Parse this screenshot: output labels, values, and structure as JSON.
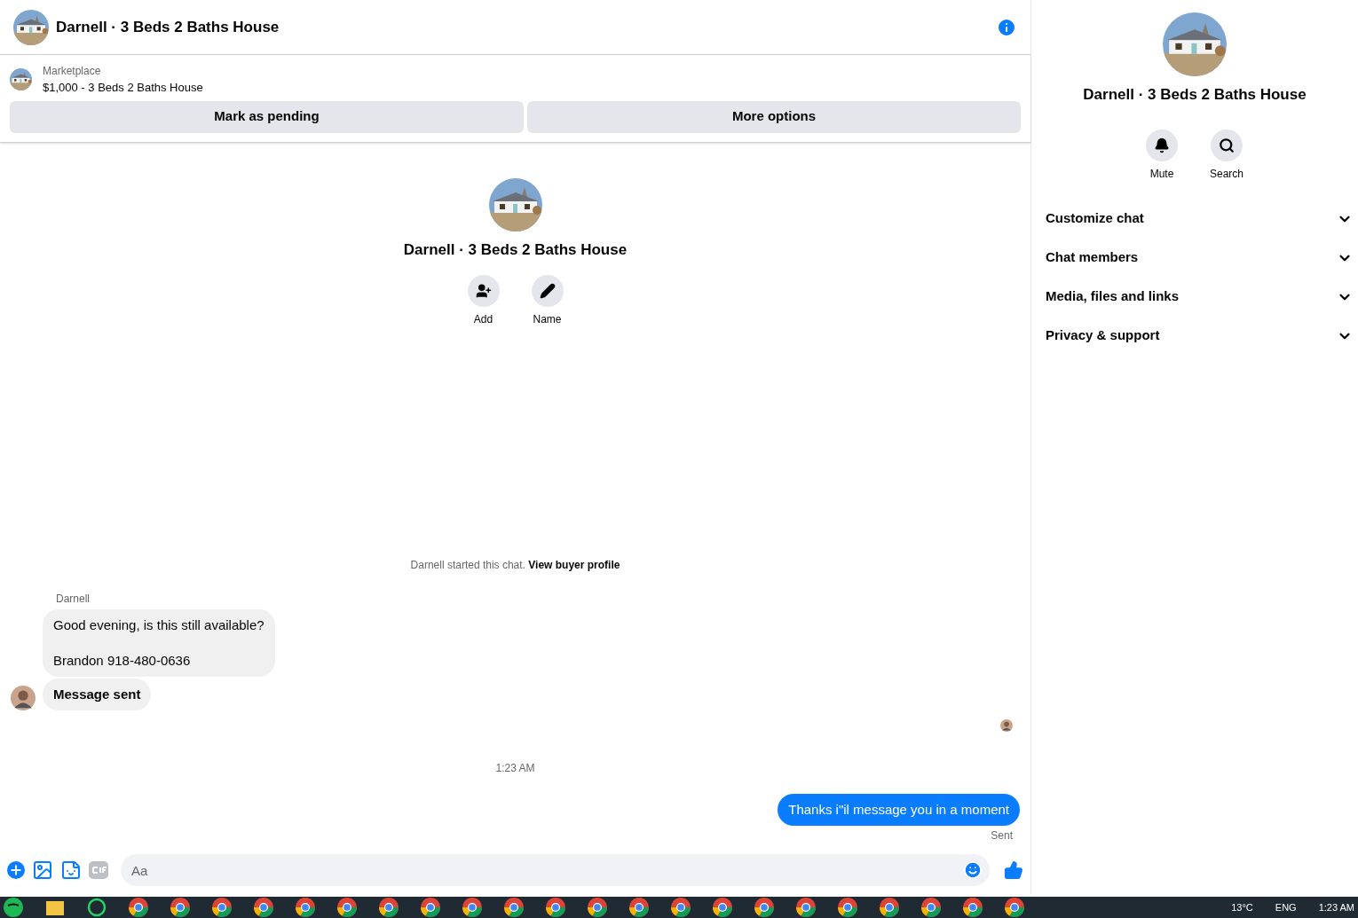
{
  "header": {
    "title": "Darnell · 3 Beds 2 Baths House"
  },
  "listing": {
    "source": "Marketplace",
    "title": "$1,000 - 3 Beds 2 Baths House",
    "buttons": [
      "Mark as pending",
      "More options"
    ]
  },
  "intro": {
    "title": "Darnell · 3 Beds 2 Baths House",
    "actions": [
      {
        "kind": "add",
        "label": "Add"
      },
      {
        "kind": "edit",
        "label": "Name"
      }
    ]
  },
  "started": {
    "text": "Darnell started this chat.",
    "link": "View buyer profile"
  },
  "messages": [
    {
      "kind": "incoming",
      "sender": "Darnell",
      "lines": [
        "Good evening, is this still available?",
        "Brandon 918-480-0636"
      ],
      "bold": false
    },
    {
      "kind": "incoming",
      "lines": [
        "Message sent"
      ],
      "bold": true
    },
    {
      "kind": "seen"
    },
    {
      "kind": "time",
      "text": "1:23 AM"
    },
    {
      "kind": "outgoing",
      "lines": [
        "Thanks i\"il message you in a moment"
      ],
      "status": "Sent"
    }
  ],
  "composer": {
    "placeholder": "Aa"
  },
  "panel": {
    "title": "Darnell · 3 Beds 2 Baths House",
    "actions": [
      {
        "kind": "mute",
        "label": "Mute"
      },
      {
        "kind": "search",
        "label": "Search"
      }
    ],
    "sections": [
      {
        "label": "Customize chat",
        "expanded": false
      },
      {
        "label": "Chat members",
        "expanded": false
      },
      {
        "label": "Media, files and links",
        "expanded": false
      },
      {
        "label": "Privacy & support",
        "expanded": false
      }
    ]
  },
  "taskbar": {
    "apps": [
      {
        "kind": "spotify"
      },
      {
        "kind": "folder"
      },
      {
        "kind": "whatsapp"
      },
      {
        "kind": "chrome"
      },
      {
        "kind": "chrome"
      },
      {
        "kind": "chrome"
      },
      {
        "kind": "chrome"
      },
      {
        "kind": "chrome"
      },
      {
        "kind": "chrome"
      },
      {
        "kind": "chrome"
      },
      {
        "kind": "chrome"
      },
      {
        "kind": "chrome"
      },
      {
        "kind": "chrome"
      },
      {
        "kind": "chrome"
      },
      {
        "kind": "chrome"
      },
      {
        "kind": "chrome"
      },
      {
        "kind": "chrome"
      },
      {
        "kind": "chrome"
      },
      {
        "kind": "chrome"
      },
      {
        "kind": "chrome"
      },
      {
        "kind": "chrome"
      },
      {
        "kind": "chrome"
      },
      {
        "kind": "chrome"
      },
      {
        "kind": "chrome"
      },
      {
        "kind": "chrome"
      }
    ],
    "temperature": "13°C",
    "language": "ENG",
    "time": "1:23 AM"
  }
}
